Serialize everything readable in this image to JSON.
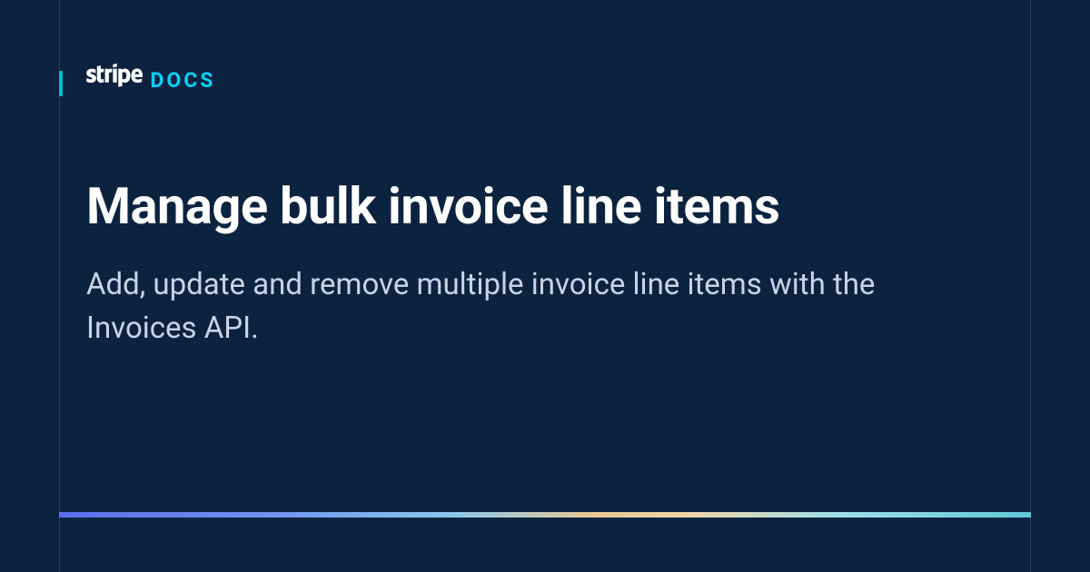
{
  "brand": {
    "name": "stripe",
    "section": "DOCS"
  },
  "title": "Manage bulk invoice line items",
  "subtitle": "Add, update and remove multiple invoice line items with the Invoices API."
}
